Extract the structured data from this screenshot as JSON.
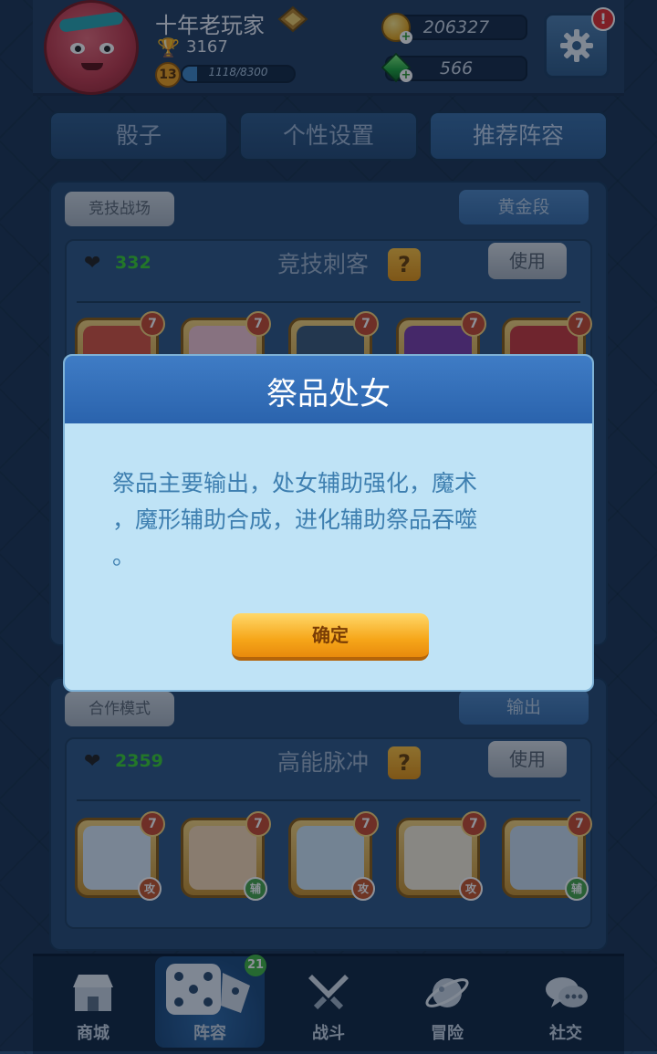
{
  "player": {
    "name": "十年老玩家",
    "trophies": "3167",
    "level": "13",
    "xp_text": "1118/8300",
    "xp_fraction": 0.135
  },
  "currency": {
    "coins": "206327",
    "gems": "566"
  },
  "settings": {
    "notification": "!"
  },
  "tabs": [
    {
      "label": "骰子"
    },
    {
      "label": "个性设置"
    },
    {
      "label": "推荐阵容"
    }
  ],
  "section1": {
    "mode": "竞技战场",
    "tier": "黄金段",
    "deck": {
      "likes": "332",
      "title": "竞技刺客",
      "help": "?",
      "use": "使用"
    },
    "dice_levels": [
      "7",
      "7",
      "7",
      "7",
      "7"
    ]
  },
  "section2": {
    "mode": "合作模式",
    "tier": "输出",
    "deck": {
      "likes": "2359",
      "title": "高能脉冲",
      "help": "?",
      "use": "使用"
    },
    "dice": [
      {
        "level": "7",
        "role": "攻",
        "role_color": "#c6552a"
      },
      {
        "level": "7",
        "role": "辅",
        "role_color": "#46a548"
      },
      {
        "level": "7",
        "role": "攻",
        "role_color": "#c6552a"
      },
      {
        "level": "7",
        "role": "攻",
        "role_color": "#c6552a"
      },
      {
        "level": "7",
        "role": "辅",
        "role_color": "#46a548"
      }
    ]
  },
  "modal": {
    "title": "祭品处女",
    "body_line1": "祭品主要输出，处女辅助强化，魔术",
    "body_line2": "，魔形辅助合成，进化辅助祭品吞噬",
    "body_line3": "。",
    "confirm": "确定"
  },
  "nav": {
    "items": [
      {
        "label": "商城",
        "icon": "shop-icon"
      },
      {
        "label": "阵容",
        "icon": "dice-icon"
      },
      {
        "label": "战斗",
        "icon": "crossed-swords-icon"
      },
      {
        "label": "冒险",
        "icon": "planet-icon"
      },
      {
        "label": "社交",
        "icon": "chat-icon"
      }
    ],
    "badge": "21"
  }
}
